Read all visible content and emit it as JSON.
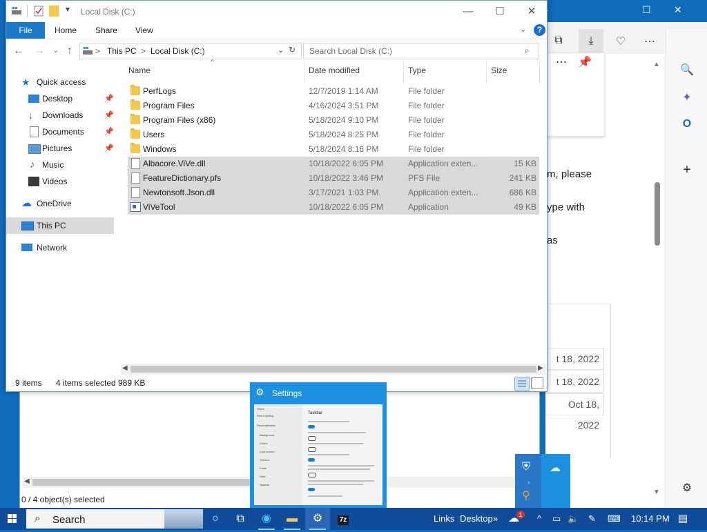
{
  "explorer": {
    "title": "Local Disk (C:)",
    "ribbon": {
      "file": "File",
      "tabs": [
        "Home",
        "Share",
        "View"
      ],
      "help": "?"
    },
    "address": {
      "root": "This PC",
      "current": "Local Disk (C:)",
      "sep": ">"
    },
    "search_placeholder": "Search Local Disk (C:)",
    "nav": {
      "quick_access": "Quick access",
      "pinned": [
        "Desktop",
        "Downloads",
        "Documents",
        "Pictures"
      ],
      "others": [
        "Music",
        "Videos"
      ],
      "onedrive": "OneDrive",
      "this_pc": "This PC",
      "network": "Network"
    },
    "columns": {
      "name": "Name",
      "date": "Date modified",
      "type": "Type",
      "size": "Size"
    },
    "rows": [
      {
        "name": "PerfLogs",
        "date": "12/7/2019 1:14 AM",
        "type": "File folder",
        "size": "",
        "kind": "folder",
        "selected": false
      },
      {
        "name": "Program Files",
        "date": "4/16/2024 3:51 PM",
        "type": "File folder",
        "size": "",
        "kind": "folder",
        "selected": false
      },
      {
        "name": "Program Files (x86)",
        "date": "5/18/2024 9:10 PM",
        "type": "File folder",
        "size": "",
        "kind": "folder",
        "selected": false
      },
      {
        "name": "Users",
        "date": "5/18/2024 8:25 PM",
        "type": "File folder",
        "size": "",
        "kind": "folder",
        "selected": false
      },
      {
        "name": "Windows",
        "date": "5/18/2024 8:16 PM",
        "type": "File folder",
        "size": "",
        "kind": "folder",
        "selected": false
      },
      {
        "name": "Albacore.ViVe.dll",
        "date": "10/18/2022 6:05 PM",
        "type": "Application exten...",
        "size": "15 KB",
        "kind": "file",
        "selected": true
      },
      {
        "name": "FeatureDictionary.pfs",
        "date": "10/18/2022 3:46 PM",
        "type": "PFS File",
        "size": "241 KB",
        "kind": "file",
        "selected": true
      },
      {
        "name": "Newtonsoft.Json.dll",
        "date": "3/17/2021 1:03 PM",
        "type": "Application exten...",
        "size": "686 KB",
        "kind": "file",
        "selected": true
      },
      {
        "name": "ViVeTool",
        "date": "10/18/2022 6:05 PM",
        "type": "Application",
        "size": "49 KB",
        "kind": "app",
        "selected": true
      }
    ],
    "status": {
      "items": "9 items",
      "selected": "4 items selected",
      "size": "989 KB"
    }
  },
  "second_window": {
    "status": "0 / 4 object(s) selected"
  },
  "edge": {
    "text_lines": [
      "m, please",
      "ype with",
      "as"
    ],
    "dates": [
      "t 18, 2022",
      "t 18, 2022",
      "Oct 18, 2022"
    ]
  },
  "thumbnail": {
    "title": "Settings",
    "preview_heading": "Taskbar",
    "preview_nav": [
      "Home",
      "Find a setting",
      "Personalization",
      "Background",
      "Colors",
      "Lock screen",
      "Themes",
      "Fonts",
      "Start",
      "Taskbar"
    ]
  },
  "taskbar": {
    "search": "Search",
    "links": "Links",
    "desktop": "Desktop",
    "chevron": "»",
    "badge": "1",
    "time": "10:14 PM"
  },
  "colors": {
    "accent": "#1979ca",
    "taskbar": "#114c9b",
    "selection": "#d9d9d9",
    "folder": "#f5c84c"
  }
}
